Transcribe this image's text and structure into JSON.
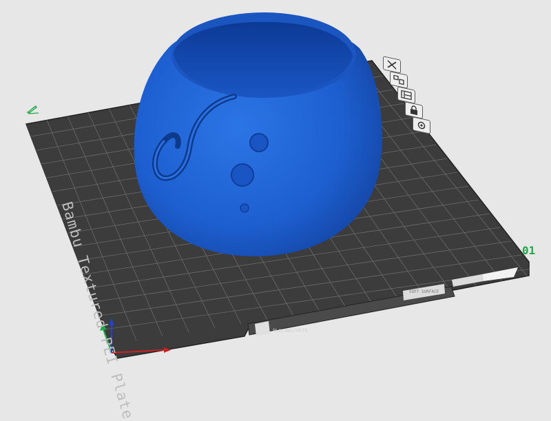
{
  "plate": {
    "number_label": "01",
    "bed_name": "Bambu Textured PEI Plate",
    "filament_tag": "PLA/ABS/PETG",
    "surface_tag": "SOFT SURFACE"
  },
  "toolbar": {
    "buttons": [
      {
        "name": "remove-plate",
        "icon": "close-icon"
      },
      {
        "name": "arrange-plate",
        "icon": "arrange-icon"
      },
      {
        "name": "orient-plate",
        "icon": "orient-icon"
      },
      {
        "name": "lock-plate",
        "icon": "lock-icon"
      },
      {
        "name": "plate-settings",
        "icon": "gear-icon"
      }
    ]
  },
  "colors": {
    "background": "#e7e7e7",
    "bed": "#3c3c3c",
    "grid": "#6a6a6a",
    "model": "#1d62d2",
    "plate_label": "#1fa94a",
    "axis_x": "#cc2222",
    "axis_y": "#1fa94a",
    "axis_z": "#2244cc"
  },
  "model": {
    "description_icon": "yarn-bowl-model"
  }
}
